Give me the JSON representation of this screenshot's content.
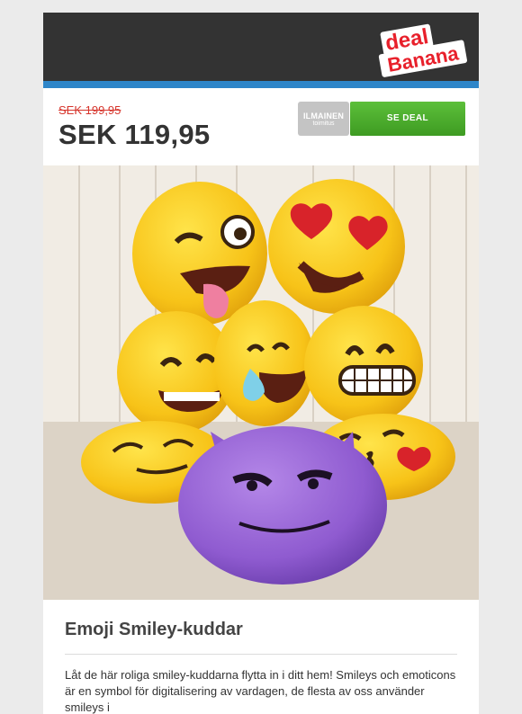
{
  "brand": {
    "logo_text_top": "deal",
    "logo_text_bottom": "Banana",
    "logo_color": "#e8202b"
  },
  "colors": {
    "header": "#333333",
    "accent_bar": "#2e86c9",
    "old_price": "#d6342b",
    "button_green": "#4caf32",
    "shipping_badge": "#c4c4c4"
  },
  "pricing": {
    "old_price": "SEK 199,95",
    "new_price": "SEK 119,95"
  },
  "shipping": {
    "line1": "ILMAINEN",
    "line2": "toimitus"
  },
  "cta": {
    "label": "SE DEAL"
  },
  "product": {
    "image_icon": "emoji-pillows-photo",
    "title": "Emoji Smiley-kuddar",
    "description": "Låt de här roliga smiley-kuddarna flytta in i ditt hem! Smileys och emoticons är en symbol för digitalisering av vardagen, de flesta av oss använder smileys i"
  }
}
